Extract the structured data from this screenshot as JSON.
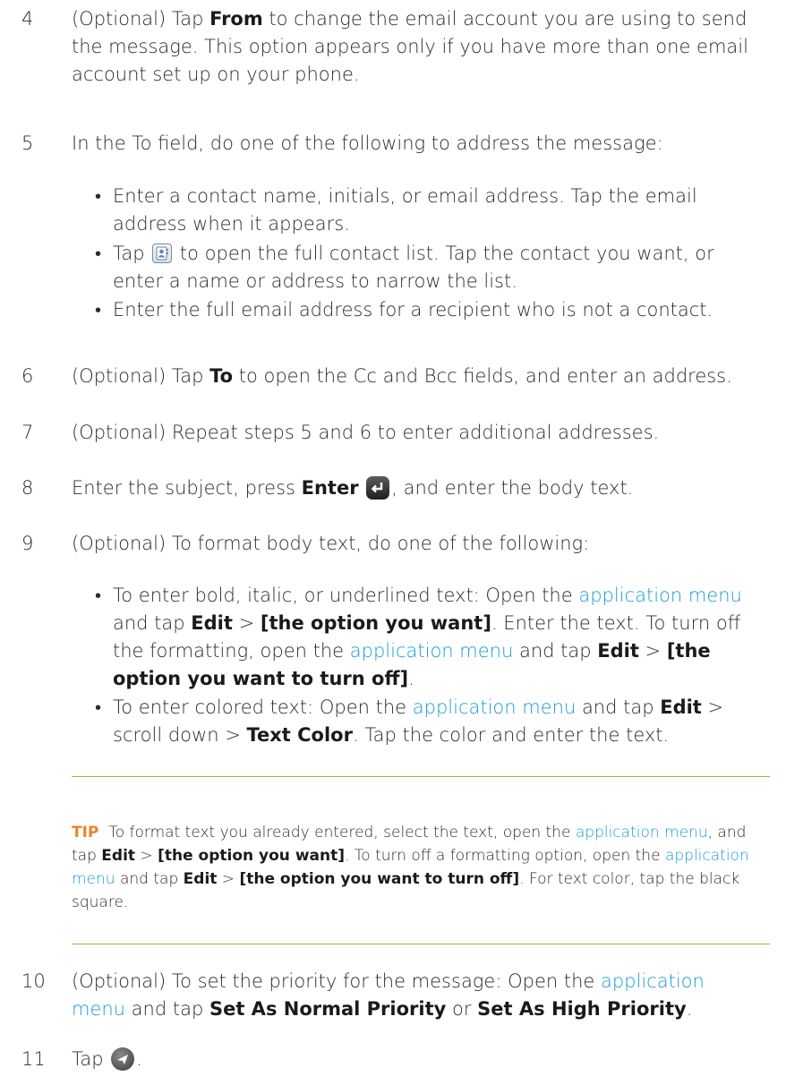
{
  "steps": {
    "s4": {
      "num": "4",
      "a": "(Optional) Tap ",
      "b": "From",
      "c": " to change the email account you are using to send the message. This option appears only if you have more than one email account set up on your phone."
    },
    "s5": {
      "num": "5",
      "text": "In the To field, do one of the following to address the message:",
      "bullet1": "Enter a contact name, initials, or email address. Tap the email address when it appears.",
      "bullet2_a": "Tap ",
      "bullet2_b": " to open the full contact list. Tap the contact you want, or enter a name or address to narrow the list.",
      "bullet3": "Enter the full email address for a recipient who is not a contact."
    },
    "s6": {
      "num": "6",
      "a": "(Optional) Tap ",
      "b": "To",
      "c": " to open the Cc and Bcc fields, and enter an address."
    },
    "s7": {
      "num": "7",
      "text": "(Optional) Repeat steps 5 and 6 to enter additional addresses."
    },
    "s8": {
      "num": "8",
      "a": "Enter the subject, press ",
      "b": "Enter",
      "c": ", and enter the body text."
    },
    "s9": {
      "num": "9",
      "text": "(Optional) To format body text, do one of the following:",
      "b1_a": "To enter bold, italic, or underlined text: Open the ",
      "b1_link": "application menu",
      "b1_b": " and tap ",
      "b1_edit": "Edit",
      "b1_c": " > ",
      "b1_opt": "[the option you want]",
      "b1_d": ". Enter the text. To turn off the formatting, open the ",
      "b1_link2": "application menu",
      "b1_e": " and tap ",
      "b1_edit2": "Edit",
      "b1_f": " > ",
      "b1_opt2": "[the option you want to turn off]",
      "b1_g": ".",
      "b2_a": "To enter colored text: Open the ",
      "b2_link": "application menu",
      "b2_b": " and tap ",
      "b2_edit": "Edit",
      "b2_c": " > scroll down > ",
      "b2_tc": "Text Color",
      "b2_d": ". Tap the color and enter the text."
    },
    "s10": {
      "num": "10",
      "a": "(Optional) To set the priority for the message: Open the ",
      "link": "application menu",
      "b": " and tap ",
      "normal": "Set As Normal Priority",
      "c": " or ",
      "high": "Set As High Priority",
      "d": "."
    },
    "s11": {
      "num": "11",
      "a": "Tap ",
      "b": "."
    }
  },
  "tip": {
    "label": "TIP",
    "a": "  To format text you already entered, select the text, open the ",
    "link1": "application menu",
    "b": ", and tap ",
    "edit1": "Edit",
    "c": " > ",
    "opt1": "[the option you want]",
    "d": ". To turn off a formatting option, open the ",
    "link2": "application menu",
    "e": " and tap ",
    "edit2": "Edit",
    "f": " > ",
    "opt2": "[the option you want to turn off]",
    "g": ". For text color, tap the black square."
  },
  "colors": {
    "link": "#1a9cd6",
    "tip_label": "#e8862a",
    "rule": "#c6a33a"
  },
  "icons": [
    "contact-list-icon",
    "enter-key-icon",
    "send-icon"
  ]
}
